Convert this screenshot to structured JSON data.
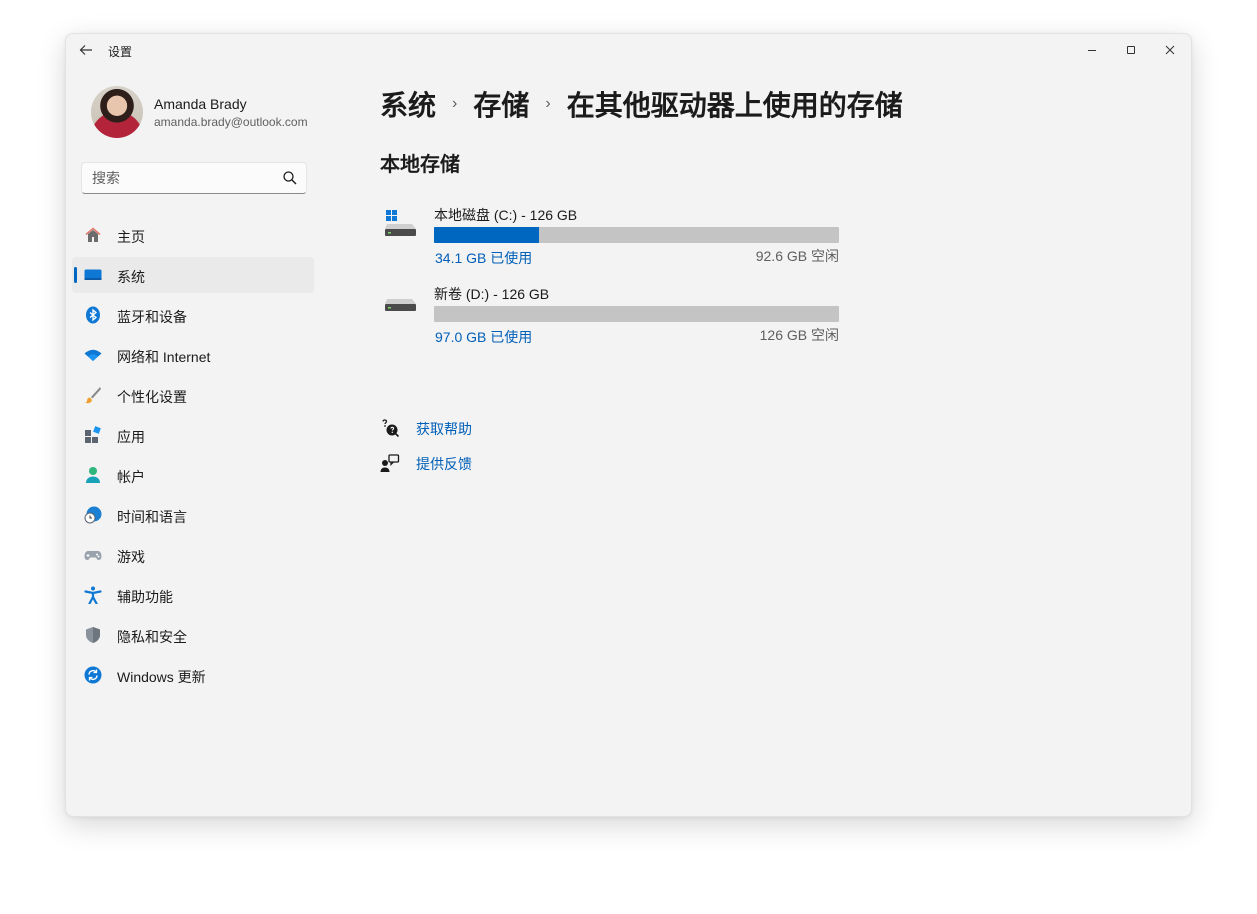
{
  "window": {
    "title": "设置",
    "back_icon": "arrow-left-icon",
    "controls": [
      "minimize",
      "maximize",
      "close"
    ]
  },
  "profile": {
    "name": "Amanda Brady",
    "email": "amanda.brady@outlook.com"
  },
  "search": {
    "placeholder": "搜索",
    "value": ""
  },
  "nav": {
    "selected": "系统",
    "items": [
      {
        "label": "主页",
        "icon": "home-icon"
      },
      {
        "label": "系统",
        "icon": "display-icon"
      },
      {
        "label": "蓝牙和设备",
        "icon": "bluetooth-icon"
      },
      {
        "label": "网络和 Internet",
        "icon": "wifi-icon"
      },
      {
        "label": "个性化设置",
        "icon": "brush-icon"
      },
      {
        "label": "应用",
        "icon": "apps-icon"
      },
      {
        "label": "帐户",
        "icon": "person-icon"
      },
      {
        "label": "时间和语言",
        "icon": "globe-clock-icon"
      },
      {
        "label": "游戏",
        "icon": "gamepad-icon"
      },
      {
        "label": "辅助功能",
        "icon": "accessibility-icon"
      },
      {
        "label": "隐私和安全",
        "icon": "shield-icon"
      },
      {
        "label": "Windows 更新",
        "icon": "update-icon"
      }
    ]
  },
  "breadcrumb": {
    "items": [
      "系统",
      "存储",
      "在其他驱动器上使用的存储"
    ],
    "separator": "›"
  },
  "section": {
    "title": "本地存储"
  },
  "drives": [
    {
      "name": "本地磁盘 (C:) - 126 GB",
      "used": "34.1 GB 已使用",
      "free": "92.6 GB 空闲",
      "used_fraction": 0.26,
      "icon": "system-drive-icon"
    },
    {
      "name": "新卷 (D:) - 126 GB",
      "used": "97.0 GB 已使用",
      "free": "126 GB 空闲",
      "used_fraction": 0.0,
      "icon": "drive-icon"
    }
  ],
  "links": {
    "help": "获取帮助",
    "feedback": "提供反馈"
  },
  "colors": {
    "accent": "#0067c0",
    "link": "#005fb8",
    "bar_track": "#c4c4c4",
    "window_bg": "#f3f3f3"
  }
}
